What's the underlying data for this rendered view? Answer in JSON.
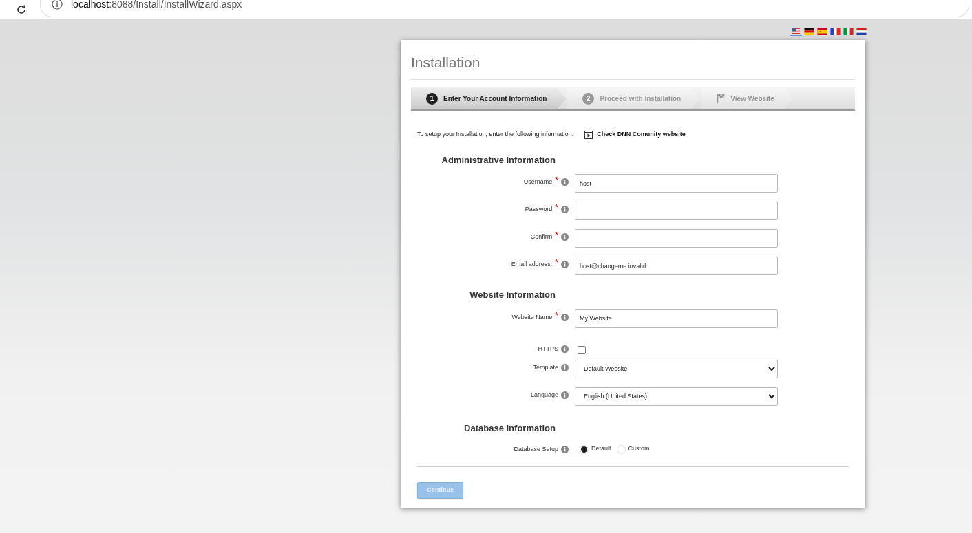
{
  "browser": {
    "address_host": "localhost",
    "address_path": ":8088/Install/InstallWizard.aspx"
  },
  "languages": [
    {
      "kind": "us",
      "selected": true
    },
    {
      "kind": "de",
      "selected": false
    },
    {
      "kind": "es",
      "selected": false
    },
    {
      "kind": "fr",
      "selected": false
    },
    {
      "kind": "it",
      "selected": false
    },
    {
      "kind": "nl",
      "selected": false
    }
  ],
  "title": "Installation",
  "steps": [
    {
      "number": "1",
      "label": "Enter Your Account Information",
      "selected": true
    },
    {
      "number": "2",
      "label": "Proceed with Installation",
      "selected": false
    },
    {
      "kind": "flag",
      "label": "View Website",
      "selected": false
    }
  ],
  "intro": "To setup your Installation, enter the following information.",
  "community_link": "Check DNN Comunity website",
  "sections": [
    {
      "heading": "Administrative Information",
      "fields": [
        {
          "kind": "text",
          "label": "Username",
          "required_mark": "*",
          "value": "host"
        },
        {
          "kind": "password",
          "label": "Password",
          "required_mark": "*"
        },
        {
          "kind": "password",
          "label": "Confirm",
          "required_mark": "*"
        },
        {
          "kind": "text",
          "label": "Email address:",
          "required_mark": "*",
          "value": "host@changeme.invalid"
        }
      ]
    },
    {
      "heading": "Website Information",
      "fields": [
        {
          "kind": "text",
          "label": "Website Name",
          "required_mark": "*",
          "value": "My Website"
        },
        {
          "kind": "checkbox",
          "label": "HTTPS",
          "checked": false
        },
        {
          "kind": "select",
          "label": "Template",
          "value": "Default Website"
        },
        {
          "kind": "select",
          "label": "Language",
          "value": "English (United States)"
        }
      ]
    },
    {
      "heading": "Database Information",
      "fields": [
        {
          "kind": "radio",
          "label": "Database Setup",
          "options": [
            {
              "label": "Default",
              "selected": true
            },
            {
              "label": "Custom",
              "selected": false
            }
          ]
        }
      ]
    }
  ],
  "continue_button": {
    "label": "Continue",
    "disabled": true
  }
}
